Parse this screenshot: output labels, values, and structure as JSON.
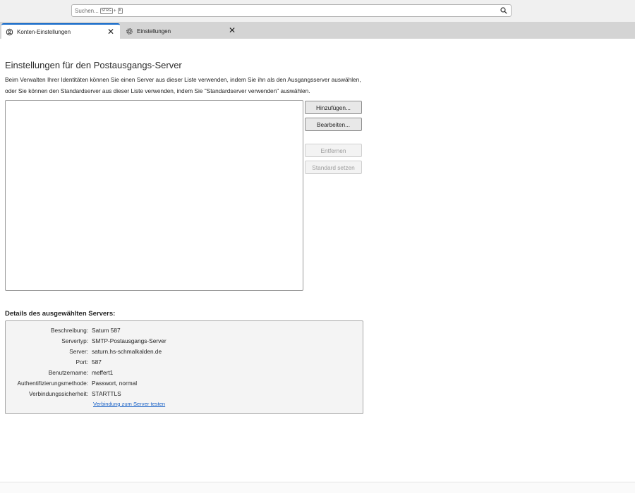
{
  "search": {
    "placeholder": "Suchen...",
    "shortcut_key1": "STRG",
    "shortcut_plus": "+",
    "shortcut_key2": "K",
    "icon": "search-icon"
  },
  "tabs": [
    {
      "label": "Konten-Einstellungen",
      "icon": "account-settings-icon",
      "close": "✕"
    },
    {
      "label": "Einstellungen",
      "icon": "gear-icon",
      "close": "✕"
    }
  ],
  "page": {
    "title": "Einstellungen für den Postausgangs-Server",
    "description": "Beim Verwalten Ihrer Identitäten können Sie einen Server aus dieser Liste verwenden, indem Sie ihn als den Ausgangsserver auswählen, oder Sie können den Standardserver aus dieser Liste verwenden, indem Sie \"Standardserver verwenden\" auswählen."
  },
  "buttons": {
    "add": "Hinzufügen...",
    "edit": "Bearbeiten...",
    "remove": "Entfernen",
    "set_default": "Standard setzen"
  },
  "details": {
    "heading": "Details des ausgewählten Servers:",
    "rows": [
      {
        "label": "Beschreibung:",
        "value": "Saturn 587"
      },
      {
        "label": "Servertyp:",
        "value": "SMTP-Postausgangs-Server"
      },
      {
        "label": "Server:",
        "value": "saturn.hs-schmalkalden.de"
      },
      {
        "label": "Port:",
        "value": "587"
      },
      {
        "label": "Benutzername:",
        "value": "meffert1"
      },
      {
        "label": "Authentifizierungsmethode:",
        "value": "Passwort, normal"
      },
      {
        "label": "Verbindungssicherheit:",
        "value": "STARTTLS"
      }
    ],
    "test_link": "Verbindung zum Server testen"
  },
  "colors": {
    "accent": "#0a64c8",
    "link": "#1a62c7"
  }
}
